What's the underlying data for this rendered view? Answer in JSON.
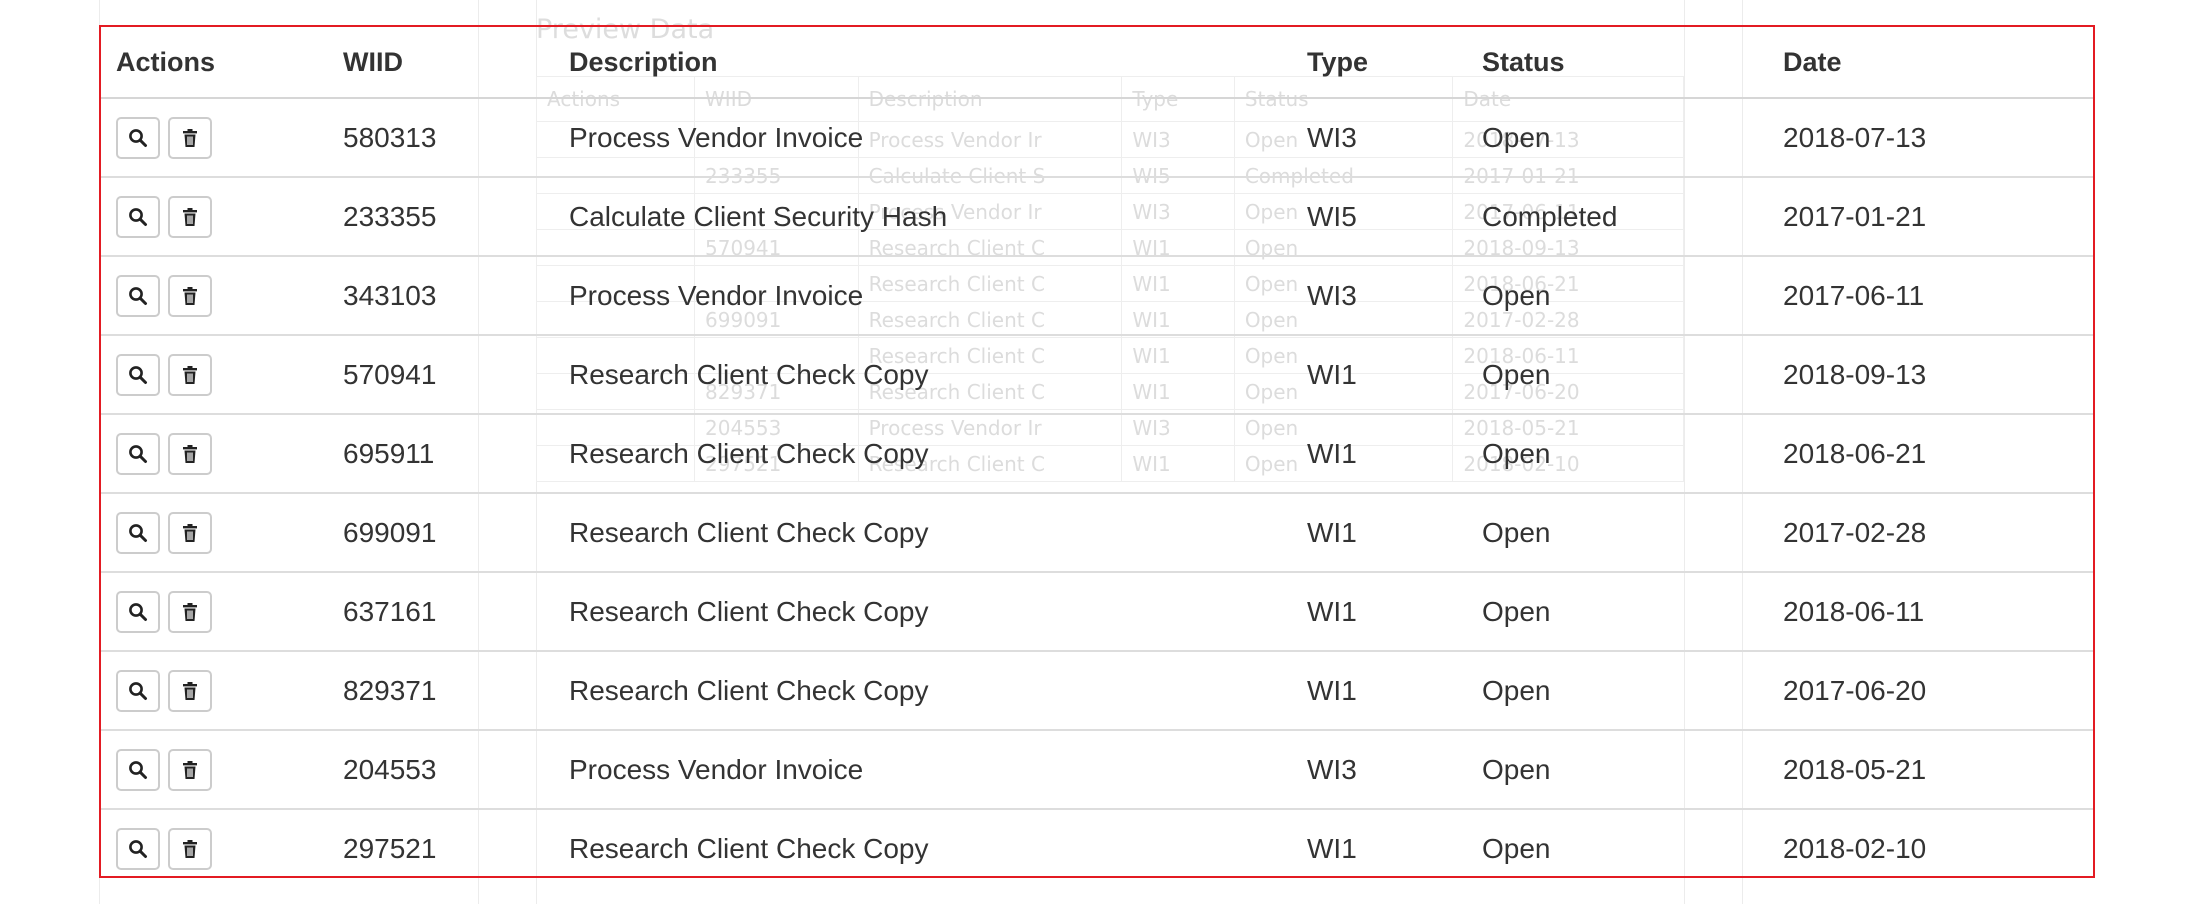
{
  "ghost": {
    "title": "Preview Data",
    "headers": [
      "Actions",
      "WIID",
      "Description",
      "Type",
      "Status",
      "Date"
    ],
    "rows": [
      [
        "",
        "",
        "Process Vendor Ir",
        "WI3",
        "Open",
        "2018-07-13"
      ],
      [
        "",
        "233355",
        "Calculate Client S",
        "WI5",
        "Completed",
        "2017-01-21"
      ],
      [
        "",
        "",
        "Process Vendor Ir",
        "WI3",
        "Open",
        "2017-06-11"
      ],
      [
        "",
        "570941",
        "Research Client C",
        "WI1",
        "Open",
        "2018-09-13"
      ],
      [
        "",
        "",
        "Research Client C",
        "WI1",
        "Open",
        "2018-06-21"
      ],
      [
        "",
        "699091",
        "Research Client C",
        "WI1",
        "Open",
        "2017-02-28"
      ],
      [
        "",
        "",
        "Research Client C",
        "WI1",
        "Open",
        "2018-06-11"
      ],
      [
        "",
        "829371",
        "Research Client C",
        "WI1",
        "Open",
        "2017-06-20"
      ],
      [
        "",
        "204553",
        "Process Vendor Ir",
        "WI3",
        "Open",
        "2018-05-21"
      ],
      [
        "",
        "297521",
        "Research Client C",
        "WI1",
        "Open",
        "2018-02-10"
      ]
    ]
  },
  "table": {
    "headers": {
      "actions": "Actions",
      "wiid": "WIID",
      "description": "Description",
      "type": "Type",
      "status": "Status",
      "date": "Date"
    },
    "action_icons": [
      "search-icon",
      "trash-icon"
    ],
    "rows": [
      {
        "wiid": "580313",
        "description": "Process Vendor Invoice",
        "type": "WI3",
        "status": "Open",
        "date": "2018-07-13"
      },
      {
        "wiid": "233355",
        "description": "Calculate Client Security Hash",
        "type": "WI5",
        "status": "Completed",
        "date": "2017-01-21"
      },
      {
        "wiid": "343103",
        "description": "Process Vendor Invoice",
        "type": "WI3",
        "status": "Open",
        "date": "2017-06-11"
      },
      {
        "wiid": "570941",
        "description": "Research Client Check Copy",
        "type": "WI1",
        "status": "Open",
        "date": "2018-09-13"
      },
      {
        "wiid": "695911",
        "description": "Research Client Check Copy",
        "type": "WI1",
        "status": "Open",
        "date": "2018-06-21"
      },
      {
        "wiid": "699091",
        "description": "Research Client Check Copy",
        "type": "WI1",
        "status": "Open",
        "date": "2017-02-28"
      },
      {
        "wiid": "637161",
        "description": "Research Client Check Copy",
        "type": "WI1",
        "status": "Open",
        "date": "2018-06-11"
      },
      {
        "wiid": "829371",
        "description": "Research Client Check Copy",
        "type": "WI1",
        "status": "Open",
        "date": "2017-06-20"
      },
      {
        "wiid": "204553",
        "description": "Process Vendor Invoice",
        "type": "WI3",
        "status": "Open",
        "date": "2018-05-21"
      },
      {
        "wiid": "297521",
        "description": "Research Client Check Copy",
        "type": "WI1",
        "status": "Open",
        "date": "2018-02-10"
      }
    ]
  },
  "colors": {
    "highlight_border": "#e31b23",
    "text": "#333333",
    "row_divider": "#dddddd",
    "ghost_text": "#dcdcdc"
  }
}
